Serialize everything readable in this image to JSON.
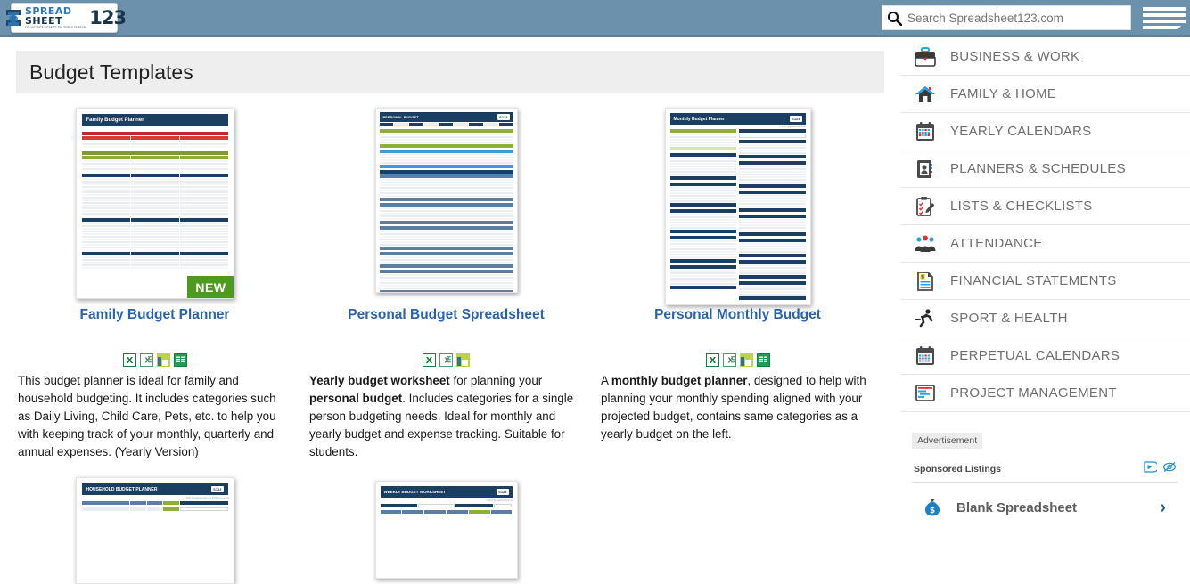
{
  "header": {
    "logo": {
      "word1": "SPREAD",
      "word2": "SHEET",
      "numerals": "123",
      "tagline": "THE ULTIMATE GUIDE TO THE WORLD OF EXCEL"
    },
    "search": {
      "placeholder": "Search Spreadsheet123.com",
      "value": "",
      "icon": "search-icon"
    },
    "menu_icon": "hamburger-menu-icon"
  },
  "main": {
    "page_title": "Budget Templates",
    "cards": [
      {
        "title": "Family Budget Planner",
        "badge": "NEW",
        "thumb_title": "Family Budget Planner",
        "formats": [
          "xls-icon",
          "xlsx-icon",
          "numbers-icon",
          "google-sheets-icon"
        ],
        "desc_lead": "",
        "desc": "This budget planner is ideal for family and household budgeting. It includes categories such as Daily Living, Child Care, Pets, etc. to help you with keeping track of your monthly, quarterly and annual expenses. (Yearly Version)"
      },
      {
        "title": "Personal Budget Spreadsheet",
        "badge": "",
        "thumb_title": "PERSONAL BUDGET",
        "formats": [
          "xls-icon",
          "xlsx-icon",
          "numbers-icon"
        ],
        "desc_lead": "Yearly budget worksheet",
        "desc_mid": " for planning your ",
        "desc_lead2": "personal budget",
        "desc": ". Includes categories for a single person budgeting needs. Ideal for monthly and yearly budget and expense tracking. Suitable for students."
      },
      {
        "title": "Personal Monthly Budget",
        "badge": "",
        "thumb_title": "Monthly Budget Planner",
        "formats": [
          "xls-icon",
          "xlsx-icon",
          "numbers-icon",
          "google-sheets-icon"
        ],
        "desc_lead": "A ",
        "desc_bold": "monthly budget planner",
        "desc": ", designed to help with planning your monthly spending aligned with your projected budget, contains same categories as a yearly budget on the left."
      }
    ],
    "next_row": [
      {
        "thumb_title": "HOUSEHOLD BUDGET PLANNER"
      },
      {
        "thumb_title": "WEEKLY BUDGET WORKSHEET"
      }
    ]
  },
  "sidebar": {
    "items": [
      {
        "label": "BUSINESS & WORK",
        "icon": "briefcase-icon"
      },
      {
        "label": "FAMILY & HOME",
        "icon": "house-icon"
      },
      {
        "label": "YEARLY CALENDARS",
        "icon": "calendar-icon"
      },
      {
        "label": "PLANNERS & SCHEDULES",
        "icon": "contact-card-icon"
      },
      {
        "label": "LISTS & CHECKLISTS",
        "icon": "clipboard-checklist-icon"
      },
      {
        "label": "ATTENDANCE",
        "icon": "people-group-icon"
      },
      {
        "label": "FINANCIAL STATEMENTS",
        "icon": "document-dollar-icon"
      },
      {
        "label": "SPORT & HEALTH",
        "icon": "runner-icon"
      },
      {
        "label": "PERPETUAL CALENDARS",
        "icon": "calendar-icon"
      },
      {
        "label": "PROJECT MANAGEMENT",
        "icon": "gantt-chart-icon"
      }
    ],
    "ad": {
      "label": "Advertisement",
      "sponsored_title": "Sponsored Listings",
      "adchoices_icon": "adchoices-icon",
      "hide-ad_icon": "hide-ad-eye-icon",
      "listing_title": "Blank Spreadsheet",
      "listing_icon": "money-bag-icon",
      "arrow_icon": "chevron-right-icon"
    }
  },
  "colors": {
    "header_bg": "#6b91ac",
    "title_bar_bg": "#eeeeee",
    "link_blue": "#2b63ab",
    "badge_green": "#4e9a1f",
    "sidebar_text": "#6e6e6e"
  }
}
